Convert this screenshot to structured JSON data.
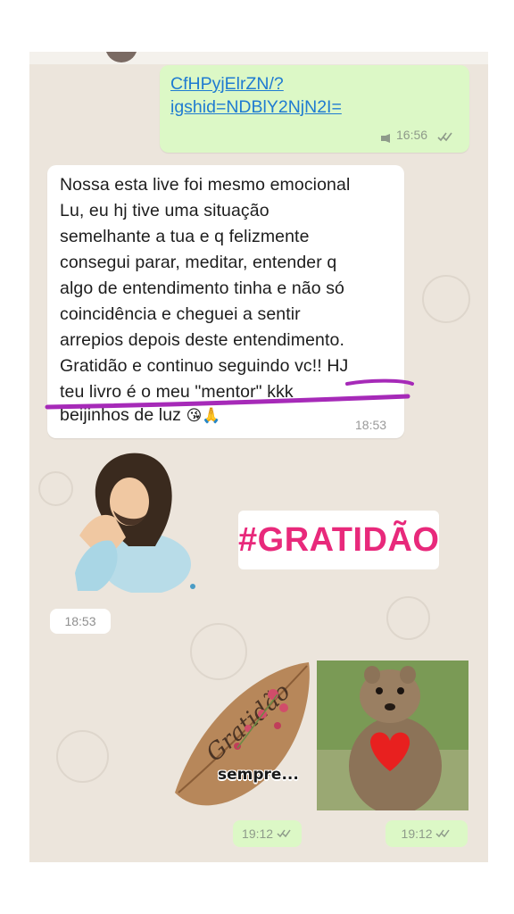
{
  "messages": {
    "link_message": {
      "url_line1": "CfHPyjElrZN/?",
      "url_line2": "igshid=NDBlY2NjN2I=",
      "time": "16:56",
      "mic_icon": "microphone-icon",
      "status_icon": "double-check-icon"
    },
    "text_message": {
      "lines": [
        "Nossa esta live foi mesmo emocional",
        "Lu, eu hj tive uma situação",
        "semelhante a tua e q felizmente",
        "consegui parar, meditar, entender q",
        "algo de entendimento tinha e não só",
        "coincidência e cheguei a sentir",
        "arrepios depois deste entendimento.",
        "Gratidão e continuo seguindo vc!! HJ",
        "teu livro é o meu \"mentor\" kkk",
        "beijinhos de luz"
      ],
      "emojis": "😘🙏",
      "time": "18:53",
      "underline_color": "#a62ab8"
    },
    "sticker_row": {
      "praying_sticker_icon": "praying-jesus-sticker",
      "gratidao_text": "#GRATIDÃO",
      "gratidao_color": "#e8297b",
      "time": "18:53"
    },
    "image_row": {
      "leaf_sticker_text": "Gratidão",
      "sempre_text": "sempre...",
      "left_time": "19:12",
      "right_time": "19:12",
      "quokka_image": "quokka-heart-image"
    }
  },
  "colors": {
    "chat_background": "#ece5dc",
    "outgoing_bubble": "#dcf8c6",
    "incoming_bubble": "#ffffff",
    "link": "#1f7bd1"
  }
}
